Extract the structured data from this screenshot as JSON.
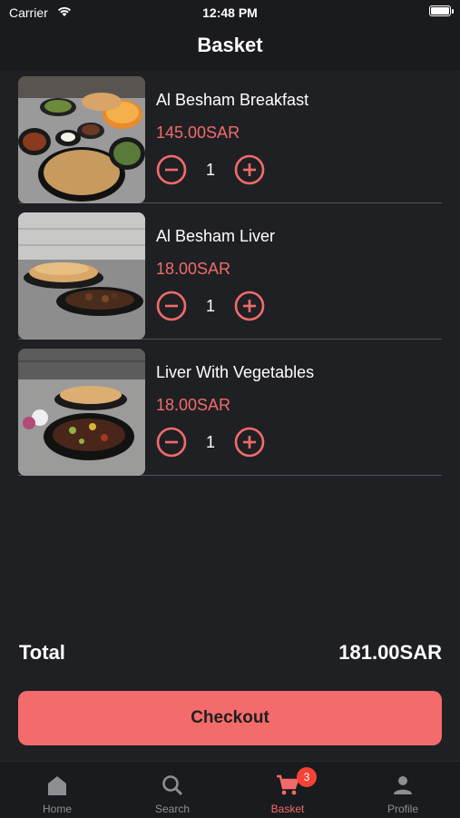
{
  "status_bar": {
    "carrier": "Carrier",
    "time": "12:48 PM"
  },
  "header": {
    "title": "Basket"
  },
  "basket": {
    "items": [
      {
        "name": "Al Besham Breakfast",
        "price": "145.00SAR",
        "quantity": "1"
      },
      {
        "name": "Al Besham Liver",
        "price": "18.00SAR",
        "quantity": "1"
      },
      {
        "name": "Liver With Vegetables",
        "price": "18.00SAR",
        "quantity": "1"
      }
    ]
  },
  "summary": {
    "total_label": "Total",
    "total_value": "181.00SAR"
  },
  "checkout": {
    "label": "Checkout"
  },
  "tabs": [
    {
      "label": "Home",
      "icon": "home-icon"
    },
    {
      "label": "Search",
      "icon": "search-icon"
    },
    {
      "label": "Basket",
      "icon": "cart-icon",
      "badge": "3"
    },
    {
      "label": "Profile",
      "icon": "person-icon"
    }
  ],
  "colors": {
    "accent": "#f26b6b",
    "background": "#1f2023",
    "badge": "#f44336"
  }
}
